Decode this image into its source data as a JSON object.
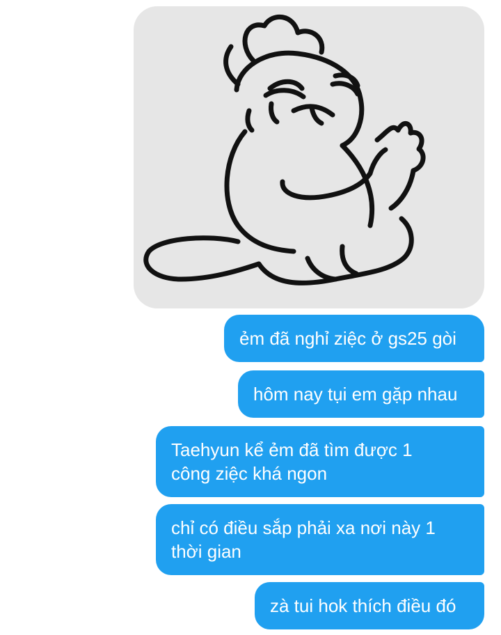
{
  "conversation": {
    "sticker": {
      "icon": "crying-cat-sticker-icon",
      "background_color": "#e6e6e6"
    },
    "bubble_color": "#20a0f0",
    "messages": [
      {
        "text": "ẻm đã nghỉ ziệc ở gs25 gòi"
      },
      {
        "text": "hôm nay tụi em gặp nhau"
      },
      {
        "text": "Taehyun kể ẻm đã tìm được 1\ncông ziệc khá ngon"
      },
      {
        "text": "chỉ có điều sắp phải xa nơi này 1\nthời gian"
      },
      {
        "text": "zà tui hok thích điều đó"
      }
    ]
  }
}
